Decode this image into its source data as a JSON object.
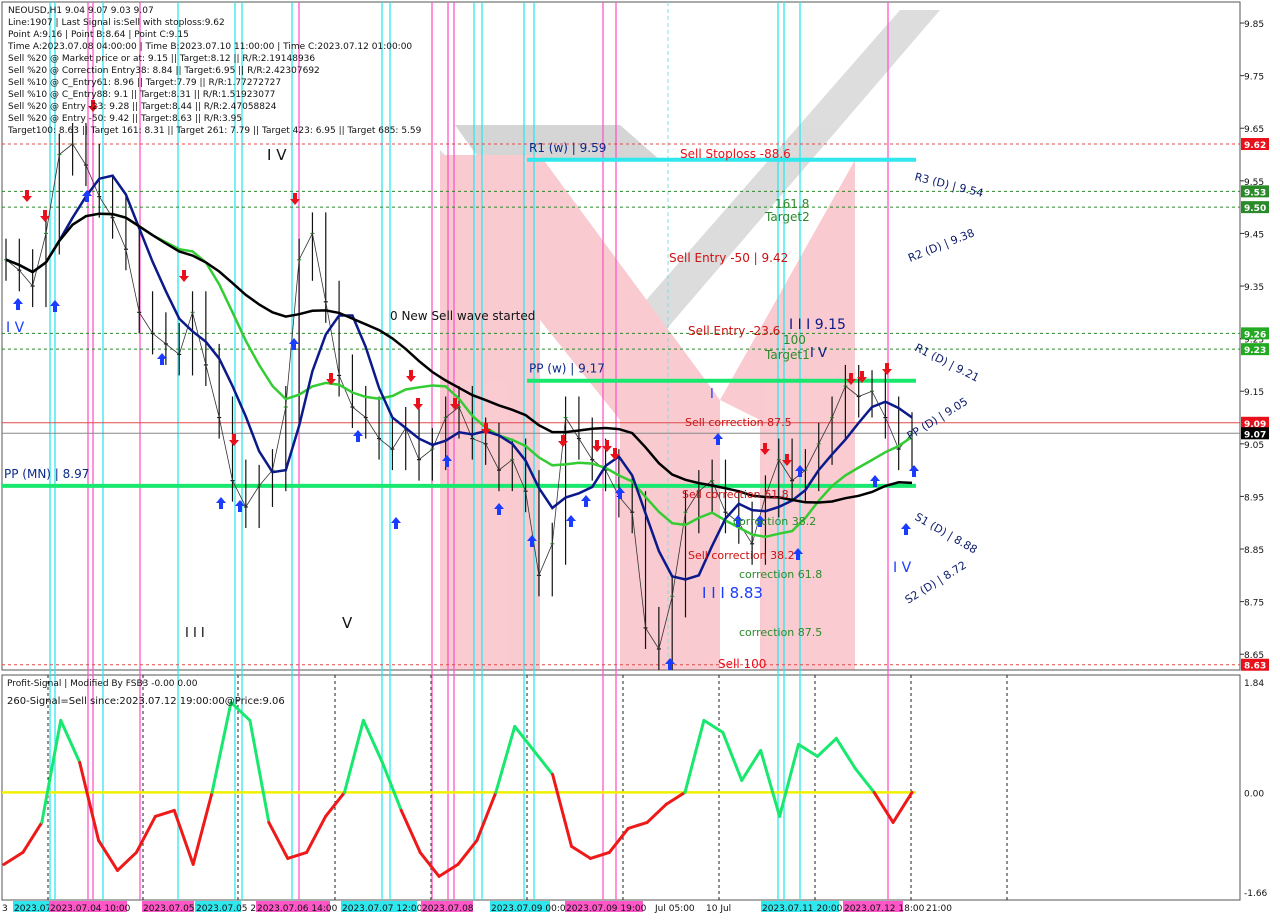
{
  "colors": {
    "bg": "#ffffff",
    "grid": "#c8c8c8",
    "up_arrow": "#1a3cff",
    "down_arrow": "#e8101a",
    "cyan": "#2ee8ee",
    "pink": "#ff57c8",
    "green_ma": "#33cc33",
    "navy_ma": "#0b1a8a",
    "black_ma": "#000000",
    "bright_green": "#19e86e",
    "sell_red": "#cc1111",
    "target_green": "#2a8a2a",
    "yellow_zero": "#f0f000"
  },
  "info": {
    "symbol_line": "NEOUSD,H1  9.04 9.07 9.03 9.07",
    "lines": [
      "Line:1907  | Last Signal is:Sell with stoploss:9.62",
      "Point A:9.16 | Point B:8.64 | Point C:9.15",
      "Time A:2023.07.08 04:00:00 | Time B:2023.07.10 11:00:00 | Time C:2023.07.12 01:00:00",
      "Sell %20 @ Market price or at: 9.15 || Target:8.12 || R/R:2.19148936",
      "Sell %20 @ Correction Entry38: 8.84 || Target:6.95 || R/R:2.42307692",
      "Sell %10 @ C_Entry61: 8.96 || Target:7.79 || R/R:1.77272727",
      "Sell %10 @ C_Entry88: 9.1 || Target:8.31 || R/R:1.51923077",
      "Sell %20 @ Entry -23: 9.28 || Target:8.44 || R/R:2.47058824",
      "Sell %20 @ Entry -50: 9.42 || Target:8.63 || R/R:3.95",
      "Target100: 8.63 || Target 161: 8.31 || Target 261: 7.79 || Target 423: 6.95 || Target 685: 5.59"
    ]
  },
  "price_axis": {
    "ticks": [
      "9.85",
      "9.75",
      "9.65",
      "9.55",
      "9.45",
      "9.35",
      "9.25",
      "9.15",
      "9.05",
      "8.95",
      "8.85",
      "8.75",
      "8.65"
    ],
    "badges": [
      {
        "label": "9.62",
        "color": "#e8101a"
      },
      {
        "label": "9.53",
        "color": "#2a8a2a"
      },
      {
        "label": "9.50",
        "color": "#2a8a2a"
      },
      {
        "label": "9.26",
        "color": "#22aa22"
      },
      {
        "label": "9.23",
        "color": "#22aa22"
      },
      {
        "label": "9.09",
        "color": "#e8101a"
      },
      {
        "label": "9.07",
        "color": "#000000"
      },
      {
        "label": "8.63",
        "color": "#e8101a"
      }
    ]
  },
  "levels": {
    "r1w": "R1 (w) | 9.59",
    "ppw": "PP (w) | 9.17",
    "ppmn": "PP (MN) | 8.97",
    "r3d": "R3 (D) | 9.54",
    "r2d": "R2 (D) | 9.38",
    "r1d": "R1 (D) | 9.21",
    "ppd": "PP (D) | 9.05",
    "s1d": "S1 (D) | 8.88",
    "s2d": "S2 (D) | 8.72"
  },
  "annotations": {
    "sell_stoploss": "Sell Stoploss -88.6",
    "fib161": "161.8",
    "target2": "Target2",
    "sell_entry_50": "Sell Entry -50 | 9.42",
    "sell_entry_23": "Sell Entry -23.6",
    "wave_iii_915": "I I I 9.15",
    "fib100": "100",
    "target1": "Target1",
    "v_mark": "I V",
    "new_wave": "0 New Sell wave started",
    "sell_corr_875": "Sell correction 87.5",
    "sell_corr_61": "Sell correction 61.8",
    "sell_corr_38": "Sell correction 38.2",
    "corr_382": "correction 38.2",
    "corr_618": "correction 61.8",
    "corr_875": "correction 87.5",
    "wave_iii_883": "I I I 8.83",
    "sell100": "Sell 100",
    "iv_top": "I V",
    "iv_left": "I V",
    "iv_right": "I V",
    "iii_bottom": "I I I",
    "v_bottom": "V",
    "i_mark": "I"
  },
  "oscillator": {
    "title": "Profit-Signal | Modified By FSB3 -0.00 0.00",
    "signal": "260-Signal=Sell since:2023.07.12 19:00:00@Price:9.06",
    "ticks": [
      "1.84",
      "0.00",
      "-1.66"
    ]
  },
  "time_axis": {
    "labels": [
      {
        "text": "3",
        "hl": "none"
      },
      {
        "text": "2023.07",
        "hl": "cyan"
      },
      {
        "text": "2023.07.04 10:00",
        "hl": "pink"
      },
      {
        "text": "2023.07.05",
        "hl": "pink"
      },
      {
        "text": "2023.07.05 2",
        "hl": "cyan"
      },
      {
        "text": "2023.07.06 14:00",
        "hl": "pink"
      },
      {
        "text": "2023.07.07 12:00",
        "hl": "cyan"
      },
      {
        "text": "2023.07.08",
        "hl": "pink"
      },
      {
        "text": "2023.07.09 00:00",
        "hl": "cyan"
      },
      {
        "text": "2023.07.09 19:00",
        "hl": "pink"
      },
      {
        "text": "Jul 05:00",
        "hl": "none"
      },
      {
        "text": "10 Jul",
        "hl": "none"
      },
      {
        "text": "2023.07.11 20:00",
        "hl": "cyan"
      },
      {
        "text": "2023.07.12 18:00",
        "hl": "pink"
      },
      {
        "text": "21:00",
        "hl": "none"
      }
    ]
  },
  "chart_data": [
    {
      "type": "line",
      "title": "NEOUSD,H1",
      "x_range": [
        "2023.07.03",
        "2023.07.12 21:00"
      ],
      "ylim": [
        8.62,
        9.89
      ],
      "series": [
        {
          "name": "NEOUSD,H1",
          "values": [
            9.4,
            9.38,
            9.35,
            9.45,
            9.6,
            9.62,
            9.58,
            9.52,
            9.48,
            9.42,
            9.3,
            9.26,
            9.24,
            9.22,
            9.3,
            9.2,
            9.1,
            8.98,
            8.93,
            8.97,
            9.0,
            9.12,
            9.4,
            9.45,
            9.32,
            9.18,
            9.12,
            9.1,
            9.06,
            9.04,
            9.08,
            9.02,
            9.04,
            9.1,
            9.12,
            9.06,
            9.05,
            9.0,
            9.02,
            8.96,
            8.8,
            8.86,
            9.1,
            9.06,
            9.02,
            9.0,
            8.95,
            8.92,
            8.7,
            8.66,
            8.76,
            8.92,
            8.96,
            8.98,
            8.92,
            8.9,
            8.86,
            8.95,
            9.02,
            8.98,
            9.0,
            9.05,
            9.1,
            9.16,
            9.14,
            9.15,
            9.1,
            9.04,
            9.07
          ]
        }
      ],
      "horizontal_levels": [
        {
          "name": "R1 (w)",
          "value": 9.59
        },
        {
          "name": "PP (w)",
          "value": 9.17
        },
        {
          "name": "PP (MN)",
          "value": 8.97
        },
        {
          "name": "R3 (D)",
          "value": 9.54
        },
        {
          "name": "R2 (D)",
          "value": 9.38
        },
        {
          "name": "R1 (D)",
          "value": 9.21
        },
        {
          "name": "PP (D)",
          "value": 9.05
        },
        {
          "name": "S1 (D)",
          "value": 8.88
        },
        {
          "name": "S2 (D)",
          "value": 8.72
        }
      ]
    },
    {
      "type": "line",
      "title": "Profit-Signal",
      "ylim": [
        -1.66,
        1.84
      ],
      "series": [
        {
          "name": "260-Signal",
          "values": [
            -1.2,
            -1.0,
            -0.5,
            1.2,
            0.5,
            -0.8,
            -1.3,
            -1.0,
            -0.4,
            -0.3,
            -1.2,
            0.0,
            1.5,
            1.2,
            -0.5,
            -1.1,
            -1.0,
            -0.4,
            0.0,
            1.2,
            0.5,
            -0.3,
            -1.0,
            -1.4,
            -1.2,
            -0.8,
            0.0,
            1.1,
            0.7,
            0.3,
            -0.9,
            -1.1,
            -1.0,
            -0.6,
            -0.5,
            -0.2,
            0.0,
            1.2,
            1.0,
            0.2,
            0.7,
            -0.4,
            0.8,
            0.6,
            0.9,
            0.4,
            0.0,
            -0.5,
            0.0
          ]
        }
      ]
    }
  ]
}
